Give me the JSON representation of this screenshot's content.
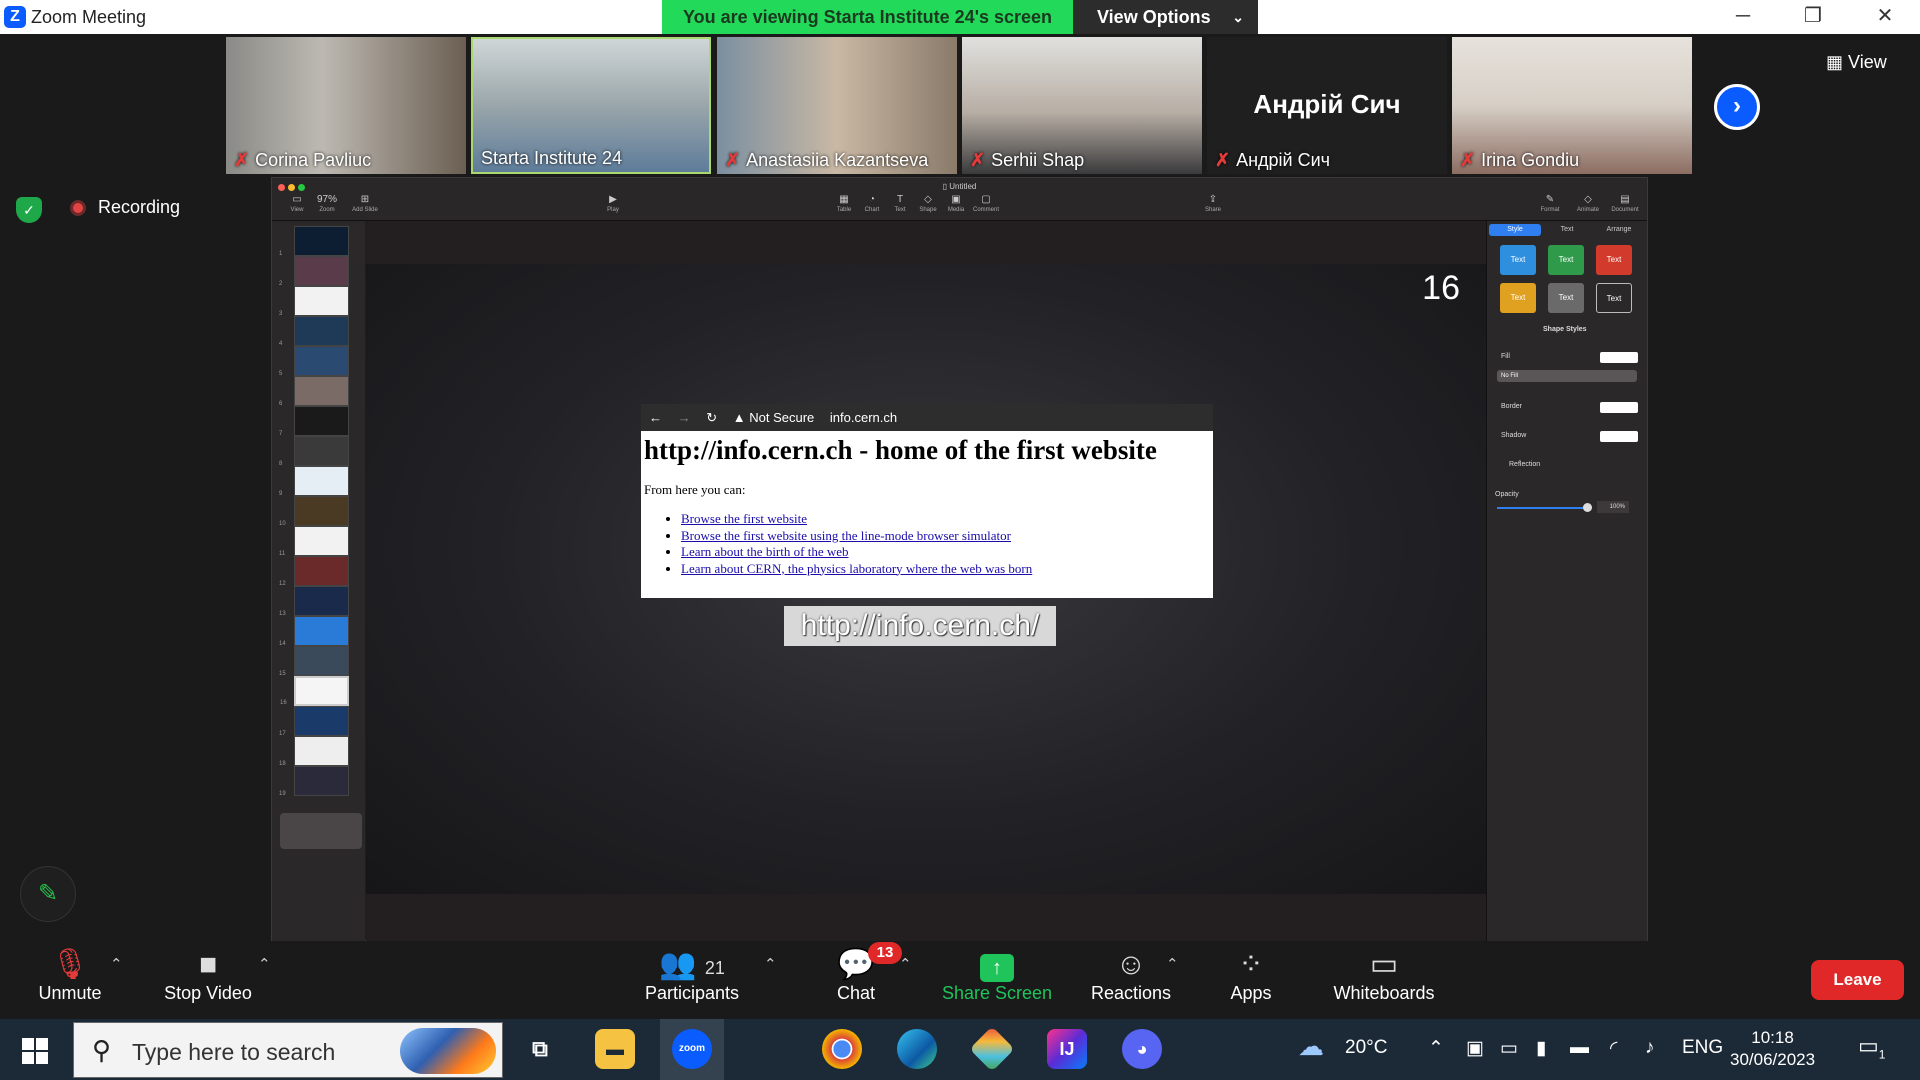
{
  "titlebar": {
    "app_title": "Zoom Meeting",
    "viewing_banner": "You are viewing Starta Institute 24's screen",
    "view_options": "View Options",
    "minimize": "─",
    "restore": "❐",
    "close": "✕"
  },
  "gallery": {
    "participants": [
      {
        "name": "Corina Pavliuc",
        "muted": true
      },
      {
        "name": "Starta Institute 24",
        "muted": false
      },
      {
        "name": "Anastasiia Kazantseva",
        "muted": true
      },
      {
        "name": "Serhii Shap",
        "muted": true
      },
      {
        "name": "Андрій Сич",
        "muted": true,
        "display_name": "Андрій Сич"
      },
      {
        "name": "Irina Gondiu",
        "muted": true
      }
    ],
    "view_label": "View"
  },
  "overlay": {
    "recording_label": "Recording"
  },
  "keynote": {
    "doc_name": "Untitled",
    "toolbar": {
      "view": "View",
      "zoom": "Zoom",
      "zoom_value": "97%",
      "add_slide": "Add Slide",
      "play": "Play",
      "table": "Table",
      "chart": "Chart",
      "text": "Text",
      "shape": "Shape",
      "media": "Media",
      "comment": "Comment",
      "share": "Share",
      "format": "Format",
      "animate": "Animate",
      "document": "Document"
    },
    "slide_numbers": [
      "1",
      "2",
      "3",
      "4",
      "5",
      "6",
      "7",
      "8",
      "9",
      "10",
      "11",
      "12",
      "13",
      "14",
      "15",
      "16",
      "17",
      "18",
      "19"
    ],
    "selected_slide": 16,
    "slide": {
      "number": "16",
      "browser": {
        "back": "←",
        "forward": "→",
        "reload": "↻",
        "security": "▲ Not Secure",
        "url": "info.cern.ch",
        "heading": "http://info.cern.ch - home of the first website",
        "intro": "From here you can:",
        "links": [
          "Browse the first website",
          "Browse the first website using the line-mode browser simulator",
          "Learn about the birth of the web",
          "Learn about CERN, the physics laboratory where the web was born"
        ]
      },
      "caption": "http://info.cern.ch/"
    },
    "inspector": {
      "tabs": [
        "Style",
        "Text",
        "Arrange"
      ],
      "swatch_label": "Text",
      "shape_styles": "Shape Styles",
      "fill": "Fill",
      "fill_value": "No Fill",
      "border": "Border",
      "shadow": "Shadow",
      "reflection": "Reflection",
      "opacity": "Opacity",
      "opacity_value": "100%",
      "swatch_colors": [
        "#2f8fdf",
        "#2f9a4a",
        "#d23b2b",
        "#e0a020",
        "#6a6a6a",
        "#2b2829"
      ]
    }
  },
  "controls": {
    "unmute": "Unmute",
    "stop_video": "Stop Video",
    "participants": "Participants",
    "participants_count": "21",
    "chat": "Chat",
    "chat_badge": "13",
    "share_screen": "Share Screen",
    "reactions": "Reactions",
    "apps": "Apps",
    "whiteboards": "Whiteboards",
    "leave": "Leave"
  },
  "taskbar": {
    "search_placeholder": "Type here to search",
    "weather": "20°C",
    "language": "ENG",
    "time": "10:18",
    "date": "30/06/2023",
    "notifications": "1",
    "zoom_label": "zoom"
  }
}
